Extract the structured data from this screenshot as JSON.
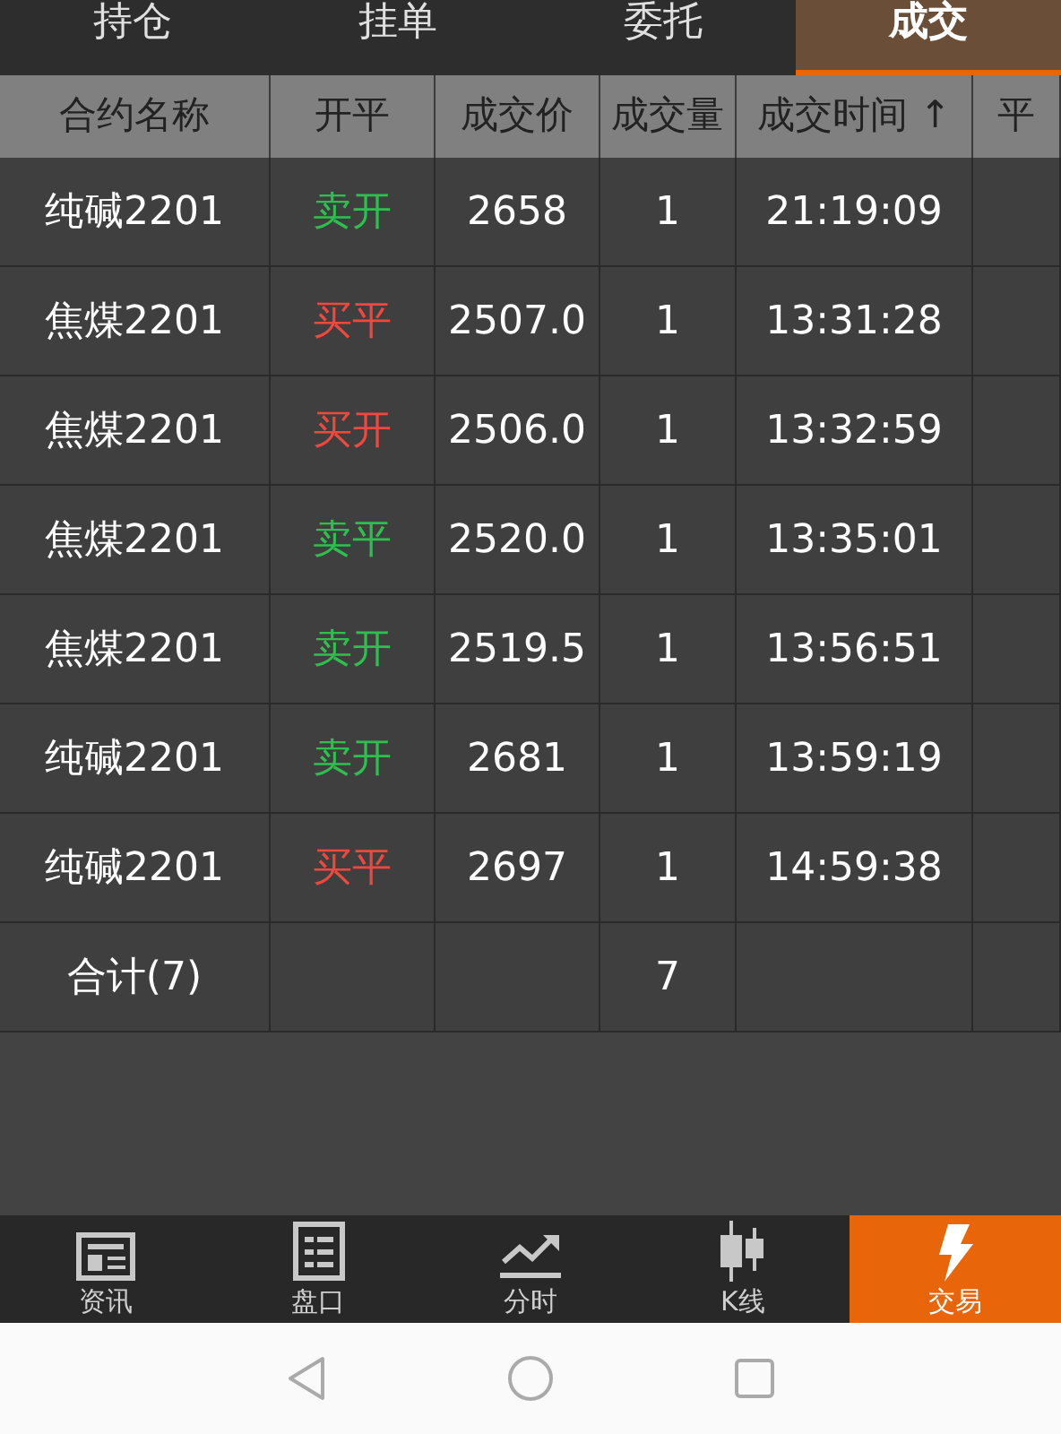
{
  "tabs": [
    {
      "label": "持仓",
      "selected": false
    },
    {
      "label": "挂单",
      "selected": false
    },
    {
      "label": "委托",
      "selected": false
    },
    {
      "label": "成交",
      "selected": true
    }
  ],
  "table": {
    "columns": [
      {
        "label": "合约名称"
      },
      {
        "label": "开平"
      },
      {
        "label": "成交价"
      },
      {
        "label": "成交量"
      },
      {
        "label": "成交时间",
        "sort_mark": "↑"
      },
      {
        "label": "平"
      }
    ],
    "rows": [
      {
        "contract": "纯碱2201",
        "side": "卖开",
        "color": "#2ec04f",
        "price": "2658",
        "volume": "1",
        "time": "21:19:09"
      },
      {
        "contract": "焦煤2201",
        "side": "买平",
        "color": "#f0483e",
        "price": "2507.0",
        "volume": "1",
        "time": "13:31:28"
      },
      {
        "contract": "焦煤2201",
        "side": "买开",
        "color": "#f0483e",
        "price": "2506.0",
        "volume": "1",
        "time": "13:32:59"
      },
      {
        "contract": "焦煤2201",
        "side": "卖平",
        "color": "#2ec04f",
        "price": "2520.0",
        "volume": "1",
        "time": "13:35:01"
      },
      {
        "contract": "焦煤2201",
        "side": "卖开",
        "color": "#2ec04f",
        "price": "2519.5",
        "volume": "1",
        "time": "13:56:51"
      },
      {
        "contract": "纯碱2201",
        "side": "卖开",
        "color": "#2ec04f",
        "price": "2681",
        "volume": "1",
        "time": "13:59:19"
      },
      {
        "contract": "纯碱2201",
        "side": "买平",
        "color": "#f0483e",
        "price": "2697",
        "volume": "1",
        "time": "14:59:38"
      }
    ],
    "total": {
      "label": "合计(7)",
      "volume": "7"
    }
  },
  "bottom_nav": [
    {
      "label": "资讯",
      "kind": "news",
      "selected": false
    },
    {
      "label": "盘口",
      "kind": "board",
      "selected": false
    },
    {
      "label": "分时",
      "kind": "trend",
      "selected": false
    },
    {
      "label": "K线",
      "kind": "candle",
      "selected": false
    },
    {
      "label": "交易",
      "kind": "bolt",
      "selected": true
    }
  ]
}
